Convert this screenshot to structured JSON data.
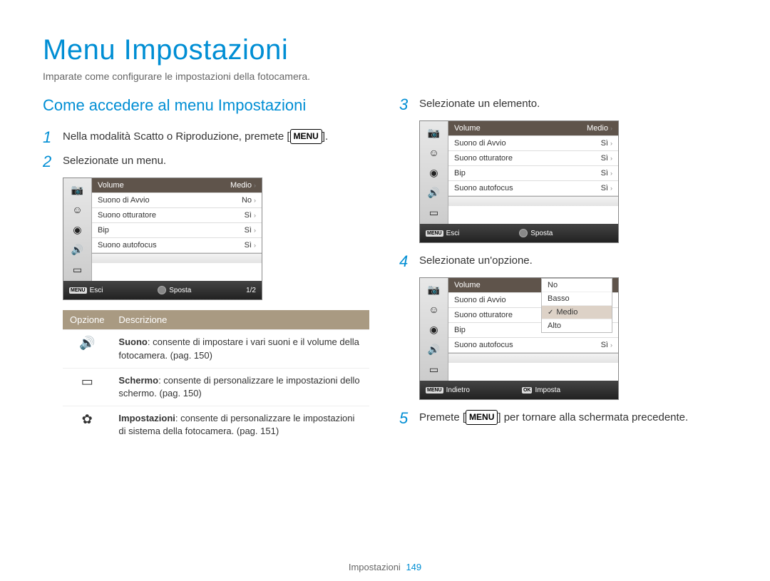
{
  "title": "Menu Impostazioni",
  "subtitle": "Imparate come configurare le impostazioni della fotocamera.",
  "section": "Come accedere al menu Impostazioni",
  "steps": {
    "s1": {
      "num": "1",
      "pre": "Nella modalità Scatto o Riproduzione, premete [",
      "btn": "MENU",
      "post": "]."
    },
    "s2": {
      "num": "2",
      "text": "Selezionate un menu."
    },
    "s3": {
      "num": "3",
      "text": "Selezionate un elemento."
    },
    "s4": {
      "num": "4",
      "text": "Selezionate un'opzione."
    },
    "s5": {
      "num": "5",
      "pre": "Premete [",
      "btn": "MENU",
      "post": "] per tornare alla schermata precedente."
    }
  },
  "screen2": {
    "rows": [
      {
        "label": "Volume",
        "value": "Medio",
        "hl": true
      },
      {
        "label": "Suono di Avvio",
        "value": "No"
      },
      {
        "label": "Suono otturatore",
        "value": "Sì"
      },
      {
        "label": "Bip",
        "value": "Sì"
      },
      {
        "label": "Suono autofocus",
        "value": "Sì"
      }
    ],
    "foot": {
      "left": "Esci",
      "mid": "Sposta",
      "right": "1/2",
      "menu": "MENU"
    }
  },
  "screen3": {
    "rows": [
      {
        "label": "Volume",
        "value": "Medio",
        "hl": true
      },
      {
        "label": "Suono di Avvio",
        "value": "Sì"
      },
      {
        "label": "Suono otturatore",
        "value": "Sì"
      },
      {
        "label": "Bip",
        "value": "Sì"
      },
      {
        "label": "Suono autofocus",
        "value": "Sì"
      }
    ],
    "foot": {
      "left": "Esci",
      "mid": "Sposta",
      "menu": "MENU"
    }
  },
  "screen4": {
    "rows": [
      {
        "label": "Volume",
        "value": "",
        "hl": true
      },
      {
        "label": "Suono di Avvio",
        "value": ""
      },
      {
        "label": "Suono otturatore",
        "value": ""
      },
      {
        "label": "Bip",
        "value": ""
      },
      {
        "label": "Suono autofocus",
        "value": "Sì"
      }
    ],
    "popup": [
      {
        "label": "No",
        "sel": false
      },
      {
        "label": "Basso",
        "sel": false
      },
      {
        "label": "Medio",
        "sel": true
      },
      {
        "label": "Alto",
        "sel": false
      }
    ],
    "foot": {
      "left": "Indietro",
      "mid": "Imposta",
      "menu": "MENU",
      "ok": "OK"
    }
  },
  "optionsHeader": {
    "col1": "Opzione",
    "col2": "Descrizione"
  },
  "options": [
    {
      "icon": "sound",
      "title": "Suono",
      "desc": ": consente di impostare i vari suoni e il volume della fotocamera. (pag. 150)"
    },
    {
      "icon": "display",
      "title": "Schermo",
      "desc": ": consente di personalizzare le impostazioni dello schermo. (pag. 150)"
    },
    {
      "icon": "gear",
      "title": "Impostazioni",
      "desc": ": consente di personalizzare le impostazioni di sistema della fotocamera. (pag. 151)"
    }
  ],
  "footer": {
    "label": "Impostazioni",
    "page": "149"
  },
  "icons": {
    "camera": "📷",
    "face": "☺",
    "record": "◉",
    "sound": "🔊",
    "display": "▭",
    "gear": "✿"
  }
}
